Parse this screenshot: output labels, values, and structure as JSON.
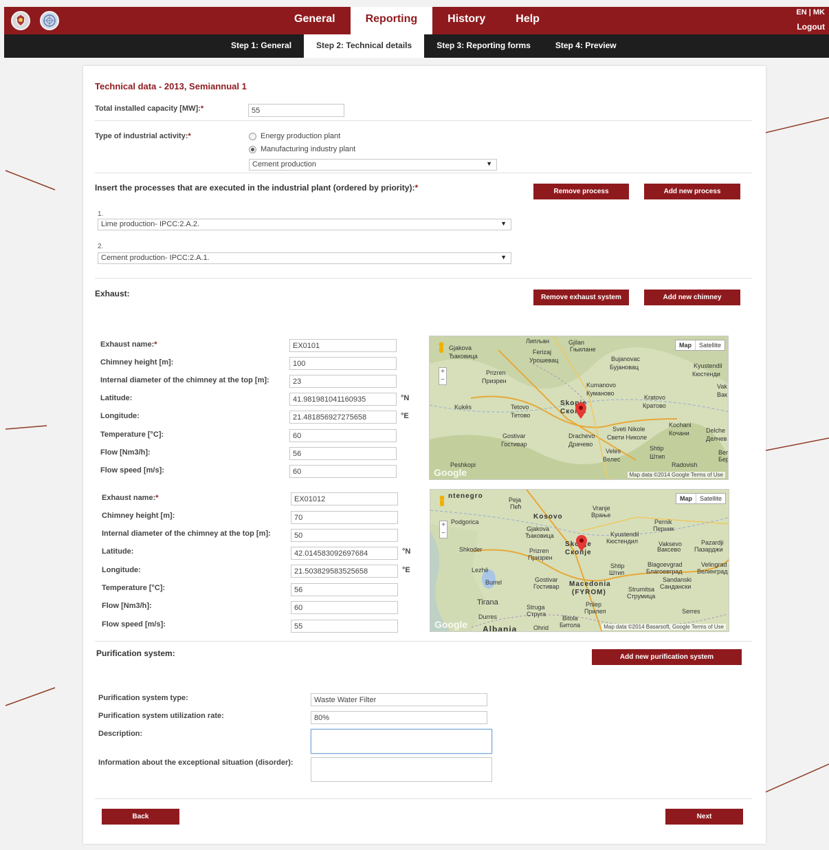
{
  "nav": {
    "tabs": [
      "General",
      "Reporting",
      "History",
      "Help"
    ],
    "active_tab": "Reporting",
    "lang": "EN | MK",
    "logout": "Logout"
  },
  "steps": {
    "items": [
      "Step 1: General",
      "Step 2: Technical details",
      "Step 3: Reporting forms",
      "Step 4: Preview"
    ],
    "active": "Step 2: Technical details"
  },
  "form": {
    "title": "Technical data - 2013, Semiannual 1",
    "capacity_label": "Total installed capacity [MW]:",
    "capacity_value": "55",
    "activity_label": "Type of industrial activity:",
    "activity_options": [
      "Energy production plant",
      "Manufacturing industry plant"
    ],
    "activity_selected": "Manufacturing industry plant",
    "industry_select": "Cement production",
    "required_mark": "*"
  },
  "processes": {
    "heading": "Insert the processes that are executed in the industrial plant (ordered by priority):",
    "remove_btn": "Remove process",
    "add_btn": "Add new process",
    "items": [
      {
        "num": "1.",
        "value": "Lime production- IPCC:2.A.2."
      },
      {
        "num": "2.",
        "value": "Cement production- IPCC:2.A.1."
      }
    ]
  },
  "exhaust": {
    "heading": "Exhaust:",
    "remove_btn": "Remove exhaust system",
    "add_btn": "Add new chimney",
    "labels": {
      "name": "Exhaust name:",
      "height": "Chimney height [m]:",
      "diameter": "Internal diameter of the chimney at the top [m]:",
      "latitude": "Latitude:",
      "longitude": "Longitude:",
      "temperature": "Temperature [°C]:",
      "flow": "Flow [Nm3/h]:",
      "speed": "Flow speed [m/s]:"
    },
    "units": {
      "lat": "°N",
      "lon": "°E"
    },
    "items": [
      {
        "name": "EX0101",
        "height": "100",
        "diameter": "23",
        "latitude": "41.981981041160935",
        "longitude": "21.481856927275658",
        "temperature": "60",
        "flow": "56",
        "speed": "60"
      },
      {
        "name": "EX01012",
        "height": "70",
        "diameter": "50",
        "latitude": "42.014583092697684",
        "longitude": "21.503829583525658",
        "temperature": "56",
        "flow": "60",
        "speed": "55"
      }
    ]
  },
  "maps": [
    {
      "toggle": [
        "Map",
        "Satellite"
      ],
      "footer": "Map data ©2014 Google   Terms of Use",
      "google": "Google",
      "places": [
        "Gjakova",
        "Ђаковица",
        "Ferizaj",
        "Урошевац",
        "Prizren",
        "Призрен",
        "Kumanovo",
        "Куманово",
        "Skopje",
        "Скопје",
        "Tetovo",
        "Тетово",
        "Gostivar",
        "Гостивар",
        "Drachevo",
        "Драчево",
        "Veles",
        "Велес",
        "Kratovo",
        "Кратово",
        "Kyustendil",
        "Кюстенди",
        "Sveti Nikole",
        "Свети Николе",
        "Kochani",
        "Кочани",
        "Shtip",
        "Штип",
        "Radovish",
        "Peshkopi",
        "Kukës",
        "Bujanovac",
        "Бујановац",
        "Липљан",
        "Gjilan",
        "Гњилане",
        "Delche",
        "Делчев",
        "Vak",
        "Вак",
        "Ber",
        "Бер"
      ]
    },
    {
      "toggle": [
        "Map",
        "Satellite"
      ],
      "footer": "Map data ©2014 Basarsoft, Google   Terms of Use",
      "google": "Google",
      "places": [
        "ntenegro",
        "Kosovo",
        "Peja",
        "Пећ",
        "Gjakova",
        "Ђаковица",
        "Vranje",
        "Врање",
        "Pernik",
        "Перник",
        "Pazardji",
        "Пазарджи",
        "Shkoder",
        "Prizren",
        "Призрен",
        "Skopje",
        "Скопје",
        "Kyustendil",
        "Кюстендил",
        "Vaksevo",
        "Ваксево",
        "Lezhë",
        "Shtip",
        "Штип",
        "Blagoevgrad",
        "Благоевград",
        "Velingrad",
        "Велинград",
        "Sandanski",
        "Сандански",
        "Gostivar",
        "Гостивар",
        "Macedonia",
        "(FYROM)",
        "Strumitsa",
        "Струмица",
        "Burrel",
        "Tirana",
        "Durres",
        "Albania",
        "Struga",
        "Струга",
        "Prilep",
        "Прилеп",
        "Bitola",
        "Битола",
        "Serres",
        "Ohrid",
        "Podgorica"
      ]
    }
  ],
  "purification": {
    "heading": "Purification system:",
    "add_btn": "Add new purification system",
    "type_label": "Purification system type:",
    "type_value": "Waste Water Filter",
    "rate_label": "Purification system utilization rate:",
    "rate_value": "80%",
    "description_label": "Description:",
    "description_value": "",
    "exceptional_label": "Information about the exceptional situation (disorder):",
    "exceptional_value": ""
  },
  "footer": {
    "back": "Back",
    "next": "Next"
  },
  "colors": {
    "brand": "#8f1a1e",
    "stepbar": "#1e1e1e"
  }
}
